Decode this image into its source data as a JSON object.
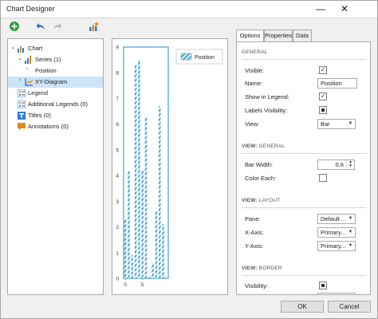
{
  "window": {
    "title": "Chart Designer",
    "minimize_glyph": "—",
    "close_glyph": "✕"
  },
  "toolbar": {
    "add_icon": "add-circle-icon",
    "undo_icon": "undo-arrow-icon",
    "redo_icon": "redo-arrow-icon",
    "wizard_icon": "chart-wizard-icon"
  },
  "tree": {
    "items": [
      {
        "label": "Chart",
        "arrow": "⌄",
        "icon": "chart-icon"
      },
      {
        "label": "Series (1)",
        "arrow": "⌄",
        "icon": "series-icon"
      },
      {
        "label": "Position",
        "arrow": "›",
        "icon": ""
      },
      {
        "label": "XY-Diagram",
        "arrow": "›",
        "icon": "diagram-icon",
        "selected": true
      },
      {
        "label": "Legend",
        "arrow": "",
        "icon": "legend-icon"
      },
      {
        "label": "Additional Legends (0)",
        "arrow": "",
        "icon": "legend-icon"
      },
      {
        "label": "Titles (0)",
        "arrow": "",
        "icon": "title-T-icon"
      },
      {
        "label": "Annotations (0)",
        "arrow": "",
        "icon": "annotation-icon"
      }
    ]
  },
  "chart_data": {
    "type": "bar",
    "series": [
      {
        "name": "Position",
        "color": "#4aa3c8"
      }
    ],
    "x": [
      0,
      1,
      2,
      3,
      4,
      5,
      6,
      7,
      8,
      9,
      10,
      11,
      12
    ],
    "values": [
      2.3,
      4.2,
      0.9,
      8.3,
      8.5,
      4.2,
      6.3,
      0.1,
      0.6,
      2.6,
      6.7,
      2.1,
      0
    ],
    "ylim": [
      0,
      9
    ],
    "yticks": [
      "0",
      "1",
      "2",
      "3",
      "4",
      "5",
      "6",
      "7",
      "8",
      "9"
    ],
    "xticks": [
      "0",
      "5"
    ],
    "legend_position": "top-right",
    "accent": "#1f8ed0"
  },
  "tabs": [
    {
      "label": "Options",
      "active": true
    },
    {
      "label": "Properties"
    },
    {
      "label": "Data"
    }
  ],
  "options": {
    "general_header": "GENERAL",
    "visible_label": "Visible:",
    "visible_checked": "✓",
    "name_label": "Name:",
    "name_value": "Position",
    "show_in_legend_label": "Show in Legend:",
    "show_in_legend_checked": "✓",
    "labels_visibility_label": "Labels Visibility:",
    "view_label": "View:",
    "view_value": "Bar",
    "view_general_header_a": "VIEW:",
    "view_general_header_b": " GENERAL",
    "bar_width_label": "Bar Width:",
    "bar_width_value": "0.6",
    "color_each_label": "Color Each:",
    "view_layout_header_a": "VIEW:",
    "view_layout_header_b": " LAYOUT",
    "pane_label": "Pane:",
    "pane_value": "Default ...",
    "x_axis_label": "X-Axis:",
    "x_axis_value": "Primary...",
    "y_axis_label": "Y-Axis:",
    "y_axis_value": "Primary...",
    "view_border_header_a": "VIEW:",
    "view_border_header_b": " BORDER",
    "visibility_label": "Visibility:"
  },
  "buttons": {
    "ok": "OK",
    "cancel": "Cancel"
  }
}
